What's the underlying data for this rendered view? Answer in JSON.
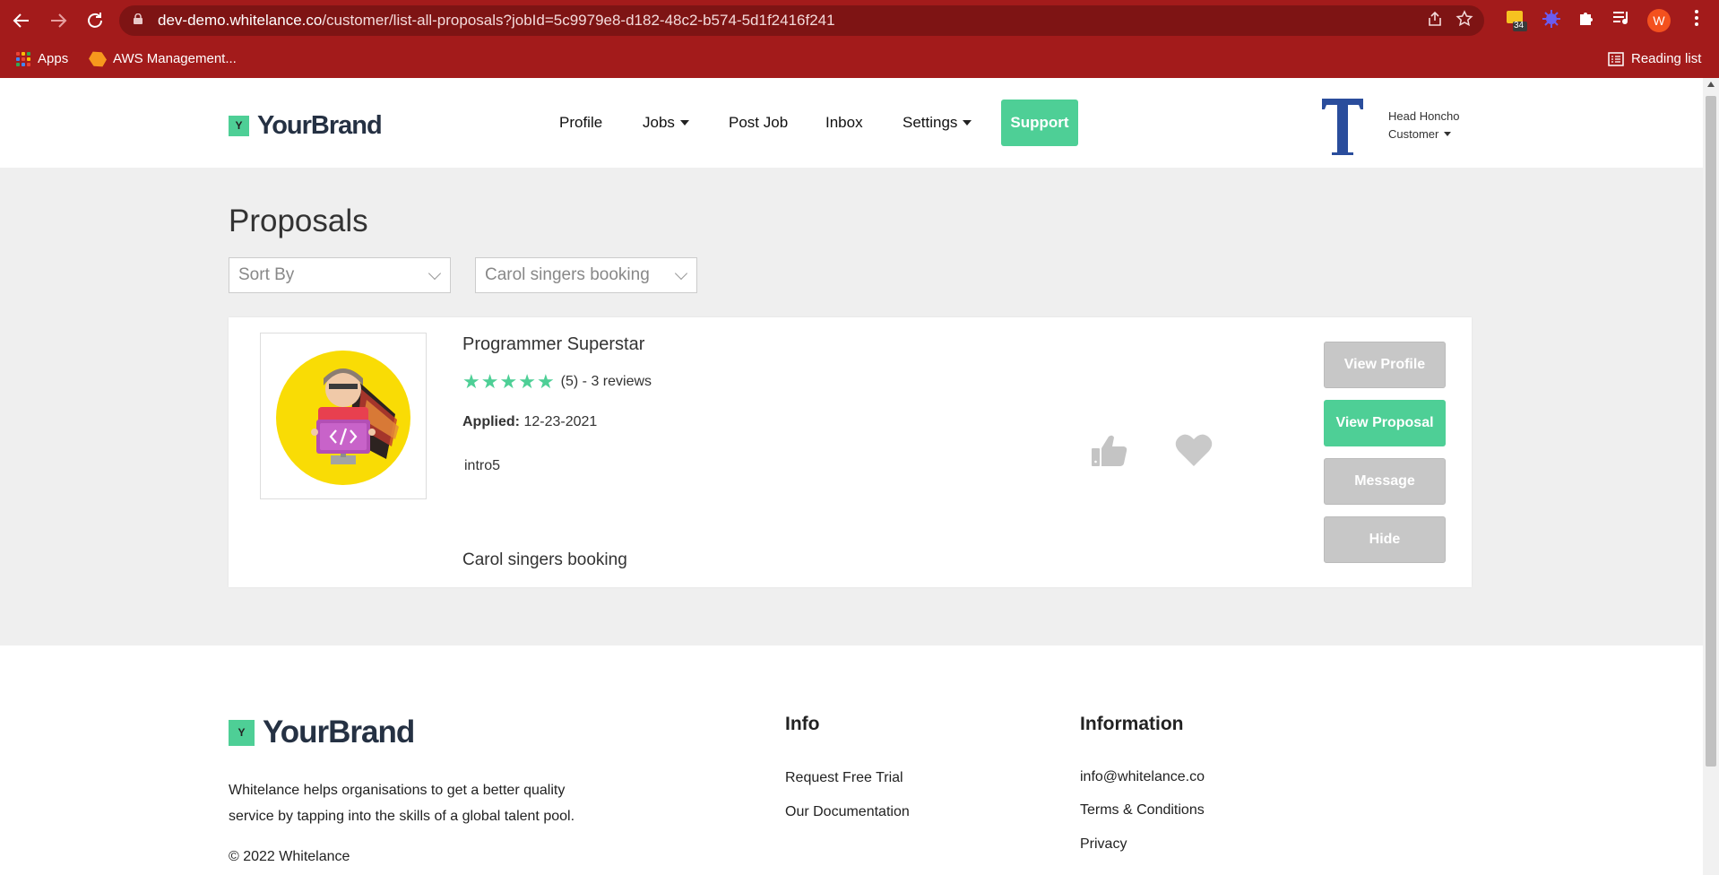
{
  "browser": {
    "url_host": "dev-demo.whitelance.co",
    "url_path": "/customer/list-all-proposals?jobId=5c9979e8-d182-48c2-b574-5d1f2416f241",
    "extension_badge": "34",
    "profile_initial": "W",
    "bookmarks": {
      "apps_label": "Apps",
      "aws_label": "AWS Management...",
      "reading_list_label": "Reading list"
    }
  },
  "header": {
    "brand_logo_letter": "Y",
    "brand_name": "YourBrand",
    "nav": {
      "profile": "Profile",
      "jobs": "Jobs",
      "post_job": "Post Job",
      "inbox": "Inbox",
      "settings": "Settings",
      "support": "Support"
    },
    "user": {
      "avatar_letter": "T",
      "name": "Head Honcho",
      "role": "Customer"
    }
  },
  "main": {
    "title": "Proposals",
    "sort_select": "Sort By",
    "job_select": "Carol singers booking",
    "proposal": {
      "name": "Programmer Superstar",
      "rating": 5,
      "rating_text": "(5) - 3 reviews",
      "applied_label": "Applied:",
      "applied_date": "12-23-2021",
      "intro": "intro5",
      "job_name": "Carol singers booking",
      "buttons": {
        "view_profile": "View Profile",
        "view_proposal": "View Proposal",
        "message": "Message",
        "hide": "Hide"
      }
    }
  },
  "footer": {
    "brand_logo_letter": "Y",
    "brand_name": "YourBrand",
    "description": "Whitelance helps organisations to get a better quality service by tapping into the skills of a global talent pool.",
    "copyright": "© 2022 Whitelance",
    "info": {
      "heading": "Info",
      "links": [
        "Request Free Trial",
        "Our Documentation"
      ]
    },
    "information": {
      "heading": "Information",
      "links": [
        "info@whitelance.co",
        "Terms & Conditions",
        "Privacy"
      ]
    }
  },
  "colors": {
    "chrome": "#a31b1b",
    "accent": "#4ecf96",
    "button_grey": "#c7c7c7",
    "brand_text": "#253143"
  }
}
